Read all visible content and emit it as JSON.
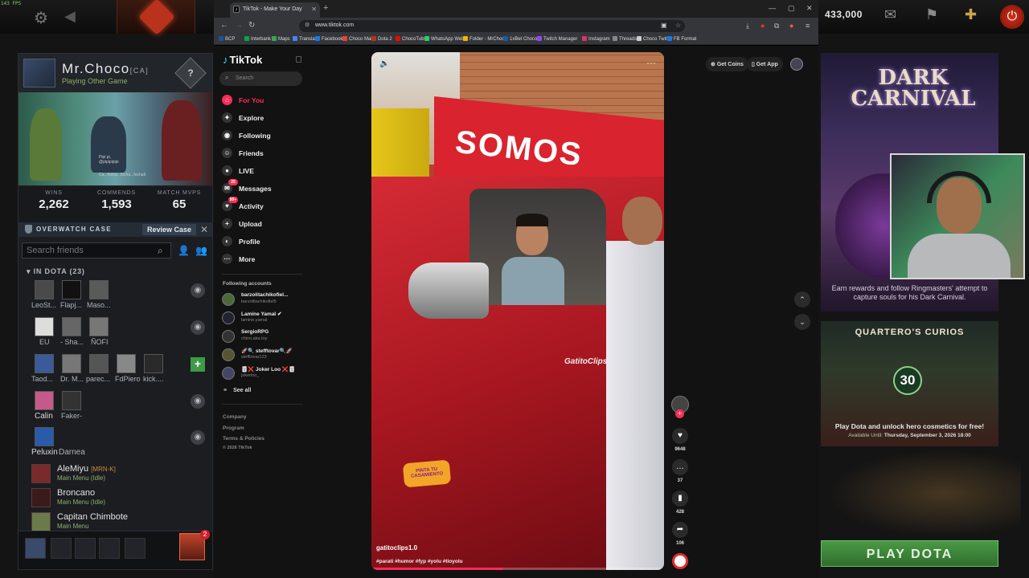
{
  "fps": "143 FPS",
  "gold": "433,000",
  "profile": {
    "name": "Mr.Choco",
    "tag": "[CA]",
    "status": "Playing Other Game",
    "rank": "?",
    "card_lines": [
      "Pipi pi,",
      "@pipipipipi",
      "Ca...focha...focha...focha6"
    ],
    "stats": [
      {
        "label": "WINS",
        "value": "2,262"
      },
      {
        "label": "COMMENDS",
        "value": "1,593"
      },
      {
        "label": "MATCH MVPS",
        "value": "65"
      }
    ]
  },
  "overwatch": {
    "title": "OVERWATCH CASE",
    "button": "Review Case"
  },
  "friends": {
    "search_placeholder": "Search friends",
    "group_title": "IN DOTA (23)",
    "rows": [
      {
        "names": [
          "LeoSt...",
          "Flapj...",
          "Maso..."
        ]
      },
      {
        "names": [
          "EU",
          "- Sha...",
          "ÑOFI"
        ]
      },
      {
        "names": [
          "Taod...",
          "Dr. M...",
          "parec...",
          "FdPiero",
          "kick...."
        ]
      },
      {
        "names": [
          "Calin",
          "Faker-"
        ]
      },
      {
        "names": [
          "Peluxin",
          "Darnea"
        ]
      }
    ],
    "list": [
      {
        "name": "AleMiyu",
        "tag": "[MRN-K]",
        "status": "Main Menu (Idle)"
      },
      {
        "name": "Broncano",
        "tag": "",
        "status": "Main Menu (Idle)"
      },
      {
        "name": "Capitan Chimbote",
        "tag": "",
        "status": "Main Menu"
      }
    ],
    "party_badge": "2"
  },
  "browser": {
    "tab_title": "TikTok - Make Your Day",
    "url": "www.tiktok.com",
    "bookmarks": [
      {
        "label": "BCP",
        "color": "#1e4fa3"
      },
      {
        "label": "Interbank",
        "color": "#00a651"
      },
      {
        "label": "Maps",
        "color": "#34a853"
      },
      {
        "label": "Translate",
        "color": "#4285f4"
      },
      {
        "label": "Facebook",
        "color": "#1877f2"
      },
      {
        "label": "Choco Mail",
        "color": "#ea4335"
      },
      {
        "label": "Dota 2",
        "color": "#b8321c"
      },
      {
        "label": "ChocoTube",
        "color": "#ff0000"
      },
      {
        "label": "WhatsApp Web",
        "color": "#25d366"
      },
      {
        "label": "Folder - MrChoco",
        "color": "#f4b400"
      },
      {
        "label": "1xBet Choco",
        "color": "#1a5aa0"
      },
      {
        "label": "Twitch Manager",
        "color": "#9146ff"
      },
      {
        "label": "Instagram",
        "color": "#e1306c"
      },
      {
        "label": "Threads",
        "color": "#888888"
      },
      {
        "label": "Choco Twitter",
        "color": "#cccccc"
      },
      {
        "label": "FB Format",
        "color": "#1877f2"
      }
    ]
  },
  "tiktok": {
    "logo": "TikTok",
    "search_placeholder": "Search",
    "nav": [
      {
        "label": "For You",
        "icon": "home-icon",
        "glyph": "⌂",
        "active": true
      },
      {
        "label": "Explore",
        "icon": "compass-icon",
        "glyph": "✦"
      },
      {
        "label": "Following",
        "icon": "following-icon",
        "glyph": "◉"
      },
      {
        "label": "Friends",
        "icon": "friends-icon",
        "glyph": "☺"
      },
      {
        "label": "LIVE",
        "icon": "live-icon",
        "glyph": "●"
      },
      {
        "label": "Messages",
        "icon": "messages-icon",
        "glyph": "✉",
        "badge": "25"
      },
      {
        "label": "Activity",
        "icon": "activity-icon",
        "glyph": "♥",
        "badge": "99+"
      },
      {
        "label": "Upload",
        "icon": "upload-icon",
        "glyph": "+"
      },
      {
        "label": "Profile",
        "icon": "profile-icon",
        "glyph": "◐"
      },
      {
        "label": "More",
        "icon": "more-icon",
        "glyph": "···"
      }
    ],
    "following_title": "Following accounts",
    "following": [
      {
        "name": "barzolitachikofiel...",
        "user": "barzolitachikofiel5"
      },
      {
        "name": "Lamine Yamal ✔",
        "user": "lamine.yamal"
      },
      {
        "name": "SergioRPG",
        "user": "chino.aka.toy"
      },
      {
        "name": "🚀🔍 stefftovar🔍🚀",
        "user": "stefftovar123"
      },
      {
        "name": "🃏❌ Joker Loo ❌🃏",
        "user": "jokerloo_"
      }
    ],
    "see_all": "See all",
    "footer": [
      "Company",
      "Program",
      "Terms & Policies",
      "© 2026 TikTok"
    ],
    "get_coins": "Get Coins",
    "get_app": "Get App",
    "video": {
      "sign_text": "SOMOS",
      "watermark": "GatitoClips",
      "sticker": "PINTA TU CASAMIENTO",
      "handle": "gatitoclips1.0",
      "caption": "#parati #humor #fyp #yolu #tioyolu",
      "progress": 0.45
    },
    "actions": [
      {
        "icon": "heart-icon",
        "glyph": "♥",
        "count": "9648"
      },
      {
        "icon": "comment-icon",
        "glyph": "…",
        "count": "37"
      },
      {
        "icon": "bookmark-icon",
        "glyph": "▮",
        "count": "428"
      },
      {
        "icon": "share-icon",
        "glyph": "➦",
        "count": "106"
      }
    ]
  },
  "promo": {
    "carnival_title": "DARK CARNIVAL",
    "carnival_desc": "Earn rewards and follow Ringmasters' attempt to capture souls for his Dark Carnival.",
    "curios_title": "QUARTERO'S CURIOS",
    "curios_level": "30",
    "curios_desc": "Play Dota and unlock hero cosmetics for free!",
    "curios_until_label": "Available Until:",
    "curios_until": "Thursday, September 3, 2026 18:00",
    "play_button": "PLAY DOTA"
  }
}
